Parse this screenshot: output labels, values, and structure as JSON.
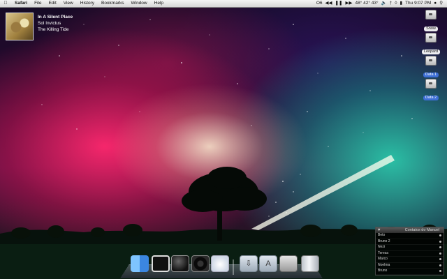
{
  "menubar": {
    "app": "Safari",
    "menus": [
      "File",
      "Edit",
      "View",
      "History",
      "Bookmarks",
      "Window",
      "Help"
    ],
    "status_text": "O6",
    "weather": "48° 42° 43°",
    "clock": "Thu 9:07 PM",
    "icons": [
      "apple-icon",
      "rewind-icon",
      "pause-icon",
      "forward-icon",
      "volume-icon",
      "bluetooth-icon",
      "wifi-icon",
      "battery-icon",
      "user-icon",
      "spotlight-icon"
    ]
  },
  "now_playing": {
    "track": "In A Silent Place",
    "artist": "Sol Invictus",
    "album": "The Killing Tide"
  },
  "desktop_drives": [
    {
      "label": "Snow"
    },
    {
      "label": "Leopard"
    },
    {
      "label": "Data 1"
    },
    {
      "label": "Data 2"
    }
  ],
  "contacts_widget": {
    "title": "Contatos do Manuel",
    "contacts": [
      "Beto",
      "Bruno 2",
      "Nezi",
      "Teresa",
      "Marco",
      "Noelma",
      "Bruno"
    ]
  },
  "dock": {
    "items": [
      "finder-icon",
      "photo-booth-icon",
      "dashboard-icon",
      "itunes-icon",
      "cloud-icon",
      "downloads-stack-icon",
      "applications-stack-icon",
      "screen-icon",
      "trash-icon"
    ]
  },
  "colors": {
    "accent_magenta": "#e0145f",
    "accent_teal": "#1fae99",
    "selection_blue": "#3d6fd6"
  }
}
